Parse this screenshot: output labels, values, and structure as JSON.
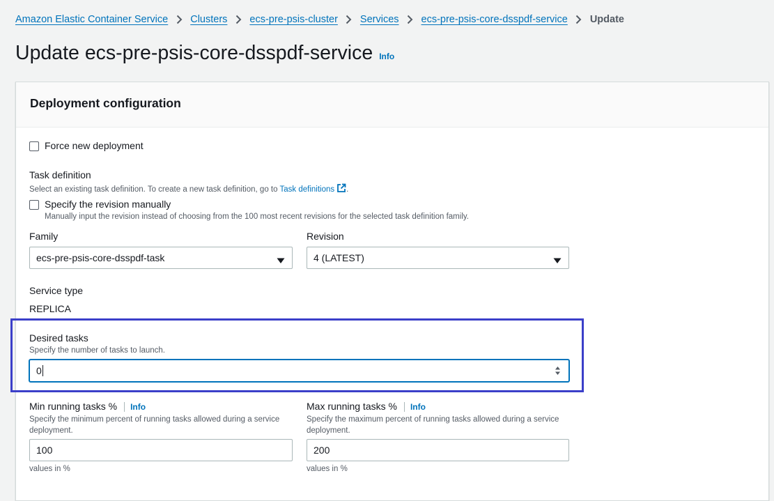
{
  "breadcrumb": {
    "items": [
      "Amazon Elastic Container Service",
      "Clusters",
      "ecs-pre-psis-cluster",
      "Services",
      "ecs-pre-psis-core-dsspdf-service"
    ],
    "current": "Update"
  },
  "page": {
    "title": "Update ecs-pre-psis-core-dsspdf-service",
    "info": "Info"
  },
  "panel": {
    "title": "Deployment configuration"
  },
  "force_deployment": {
    "label": "Force new deployment",
    "checked": false
  },
  "task_definition": {
    "label": "Task definition",
    "desc_prefix": "Select an existing task definition. To create a new task definition, go to",
    "link": "Task definitions",
    "desc_suffix": ".",
    "manual_label": "Specify the revision manually",
    "manual_desc": "Manually input the revision instead of choosing from the 100 most recent revisions for the selected task definition family."
  },
  "family": {
    "label": "Family",
    "value": "ecs-pre-psis-core-dsspdf-task"
  },
  "revision": {
    "label": "Revision",
    "value": "4 (LATEST)"
  },
  "service_type": {
    "label": "Service type",
    "value": "REPLICA"
  },
  "desired_tasks": {
    "label": "Desired tasks",
    "desc": "Specify the number of tasks to launch.",
    "value": "0"
  },
  "min_running": {
    "label": "Min running tasks %",
    "info": "Info",
    "desc": "Specify the minimum percent of running tasks allowed during a service deployment.",
    "value": "100",
    "hint": "values in %"
  },
  "max_running": {
    "label": "Max running tasks %",
    "info": "Info",
    "desc": "Specify the maximum percent of running tasks allowed during a service deployment.",
    "value": "200",
    "hint": "values in %"
  },
  "colors": {
    "link": "#0073bb",
    "highlight": "#3b3fc9",
    "focus": "#0073bb"
  }
}
